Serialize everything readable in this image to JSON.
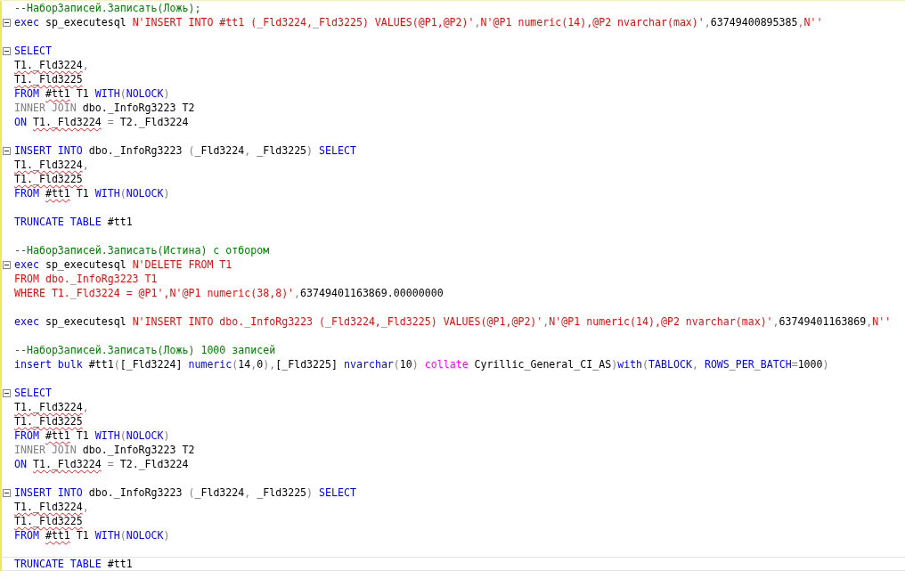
{
  "editor": {
    "lines": [
      {
        "fold": false,
        "current": false,
        "tokens": [
          {
            "kind": "comment",
            "t": "--НаборЗаписей.Записать(Ложь);"
          }
        ]
      },
      {
        "fold": true,
        "current": false,
        "tokens": [
          {
            "kind": "keyword",
            "t": "exec "
          },
          {
            "kind": "plain",
            "t": "sp_executesql "
          },
          {
            "kind": "string",
            "t": "N'INSERT INTO #tt1 (_Fld3224,_Fld3225) VALUES(@P1,@P2)'"
          },
          {
            "kind": "operator",
            "t": ","
          },
          {
            "kind": "string",
            "t": "N'@P1 numeric(14),@P2 nvarchar(max)'"
          },
          {
            "kind": "operator",
            "t": ","
          },
          {
            "kind": "plain",
            "t": "63749400895385"
          },
          {
            "kind": "operator",
            "t": ","
          },
          {
            "kind": "string",
            "t": "N''"
          }
        ]
      },
      {
        "fold": false,
        "current": false
      },
      {
        "fold": true,
        "current": false,
        "tokens": [
          {
            "kind": "keyword",
            "t": "SELECT"
          }
        ]
      },
      {
        "fold": false,
        "current": false,
        "tokens": [
          {
            "kind": "error",
            "t": "T1._Fld3224"
          },
          {
            "kind": "operator",
            "t": ","
          }
        ]
      },
      {
        "fold": false,
        "current": false,
        "tokens": [
          {
            "kind": "error",
            "t": "T1._Fld3225"
          }
        ]
      },
      {
        "fold": false,
        "current": false,
        "tokens": [
          {
            "kind": "keyword",
            "t": "FROM "
          },
          {
            "kind": "error",
            "t": "#tt1"
          },
          {
            "kind": "plain",
            "t": " T1 "
          },
          {
            "kind": "keyword",
            "t": "WITH"
          },
          {
            "kind": "operator",
            "t": "("
          },
          {
            "kind": "keyword",
            "t": "NOLOCK"
          },
          {
            "kind": "operator",
            "t": ")"
          }
        ]
      },
      {
        "fold": false,
        "current": false,
        "tokens": [
          {
            "kind": "operator",
            "t": "INNER JOIN "
          },
          {
            "kind": "plain",
            "t": "dbo._InfoRg3223 T2"
          }
        ]
      },
      {
        "fold": false,
        "current": false,
        "tokens": [
          {
            "kind": "keyword",
            "t": "ON "
          },
          {
            "kind": "error",
            "t": "T1._Fld3224"
          },
          {
            "kind": "operator",
            "t": " = "
          },
          {
            "kind": "plain",
            "t": "T2._Fld3224"
          }
        ]
      },
      {
        "fold": false,
        "current": false
      },
      {
        "fold": true,
        "current": false,
        "tokens": [
          {
            "kind": "keyword",
            "t": "INSERT INTO "
          },
          {
            "kind": "plain",
            "t": "dbo._InfoRg3223 "
          },
          {
            "kind": "operator",
            "t": "("
          },
          {
            "kind": "plain",
            "t": "_Fld3224"
          },
          {
            "kind": "operator",
            "t": ", "
          },
          {
            "kind": "plain",
            "t": "_Fld3225"
          },
          {
            "kind": "operator",
            "t": ") "
          },
          {
            "kind": "keyword",
            "t": "SELECT"
          }
        ]
      },
      {
        "fold": false,
        "current": false,
        "tokens": [
          {
            "kind": "error",
            "t": "T1._Fld3224"
          },
          {
            "kind": "operator",
            "t": ","
          }
        ]
      },
      {
        "fold": false,
        "current": false,
        "tokens": [
          {
            "kind": "error",
            "t": "T1._Fld3225"
          }
        ]
      },
      {
        "fold": false,
        "current": false,
        "tokens": [
          {
            "kind": "keyword",
            "t": "FROM "
          },
          {
            "kind": "error",
            "t": "#tt1"
          },
          {
            "kind": "plain",
            "t": " T1 "
          },
          {
            "kind": "keyword",
            "t": "WITH"
          },
          {
            "kind": "operator",
            "t": "("
          },
          {
            "kind": "keyword",
            "t": "NOLOCK"
          },
          {
            "kind": "operator",
            "t": ")"
          }
        ]
      },
      {
        "fold": false,
        "current": false
      },
      {
        "fold": false,
        "current": false,
        "tokens": [
          {
            "kind": "keyword",
            "t": "TRUNCATE TABLE "
          },
          {
            "kind": "plain",
            "t": "#tt1"
          }
        ]
      },
      {
        "fold": false,
        "current": false
      },
      {
        "fold": false,
        "current": false,
        "tokens": [
          {
            "kind": "comment",
            "t": "--НаборЗаписей.Записать(Истина) с отбором"
          }
        ]
      },
      {
        "fold": true,
        "current": false,
        "tokens": [
          {
            "kind": "keyword",
            "t": "exec "
          },
          {
            "kind": "plain",
            "t": "sp_executesql "
          },
          {
            "kind": "string",
            "t": "N'DELETE FROM T1"
          }
        ]
      },
      {
        "fold": false,
        "current": false,
        "tokens": [
          {
            "kind": "string",
            "t": "FROM dbo._InfoRg3223 T1"
          }
        ]
      },
      {
        "fold": false,
        "current": false,
        "tokens": [
          {
            "kind": "string",
            "t": "WHERE T1._Fld3224 = @P1',N'@P1 numeric(38,8)'"
          },
          {
            "kind": "operator",
            "t": ","
          },
          {
            "kind": "plain",
            "t": "63749401163869.00000000"
          }
        ]
      },
      {
        "fold": false,
        "current": false
      },
      {
        "fold": false,
        "current": false,
        "tokens": [
          {
            "kind": "keyword",
            "t": "exec "
          },
          {
            "kind": "plain",
            "t": "sp_executesql "
          },
          {
            "kind": "string",
            "t": "N'INSERT INTO dbo._InfoRg3223 (_Fld3224,_Fld3225) VALUES(@P1,@P2)'"
          },
          {
            "kind": "operator",
            "t": ","
          },
          {
            "kind": "string",
            "t": "N'@P1 numeric(14),@P2 nvarchar(max)'"
          },
          {
            "kind": "operator",
            "t": ","
          },
          {
            "kind": "plain",
            "t": "63749401163869"
          },
          {
            "kind": "operator",
            "t": ","
          },
          {
            "kind": "string",
            "t": "N''"
          }
        ]
      },
      {
        "fold": false,
        "current": false
      },
      {
        "fold": false,
        "current": false,
        "tokens": [
          {
            "kind": "comment",
            "t": "--НаборЗаписей.Записать(Ложь) 1000 записей"
          }
        ]
      },
      {
        "fold": false,
        "current": false,
        "tokens": [
          {
            "kind": "keyword",
            "t": "insert bulk "
          },
          {
            "kind": "plain",
            "t": "#tt1"
          },
          {
            "kind": "operator",
            "t": "("
          },
          {
            "kind": "plain",
            "t": "[_Fld3224] "
          },
          {
            "kind": "keyword",
            "t": "numeric"
          },
          {
            "kind": "operator",
            "t": "("
          },
          {
            "kind": "plain",
            "t": "14"
          },
          {
            "kind": "operator",
            "t": ","
          },
          {
            "kind": "plain",
            "t": "0"
          },
          {
            "kind": "operator",
            "t": "),"
          },
          {
            "kind": "plain",
            "t": "[_Fld3225] "
          },
          {
            "kind": "keyword",
            "t": "nvarchar"
          },
          {
            "kind": "operator",
            "t": "("
          },
          {
            "kind": "plain",
            "t": "10"
          },
          {
            "kind": "operator",
            "t": ") "
          },
          {
            "kind": "function",
            "t": "collate "
          },
          {
            "kind": "plain",
            "t": "Cyrillic_General_CI_AS"
          },
          {
            "kind": "operator",
            "t": ")"
          },
          {
            "kind": "keyword",
            "t": "with"
          },
          {
            "kind": "operator",
            "t": "("
          },
          {
            "kind": "keyword",
            "t": "TABLOCK"
          },
          {
            "kind": "operator",
            "t": ", "
          },
          {
            "kind": "keyword",
            "t": "ROWS_PER_BATCH"
          },
          {
            "kind": "operator",
            "t": "="
          },
          {
            "kind": "plain",
            "t": "1000"
          },
          {
            "kind": "operator",
            "t": ")"
          }
        ]
      },
      {
        "fold": false,
        "current": false
      },
      {
        "fold": true,
        "current": false,
        "tokens": [
          {
            "kind": "keyword",
            "t": "SELECT"
          }
        ]
      },
      {
        "fold": false,
        "current": false,
        "tokens": [
          {
            "kind": "error",
            "t": "T1._Fld3224"
          },
          {
            "kind": "operator",
            "t": ","
          }
        ]
      },
      {
        "fold": false,
        "current": false,
        "tokens": [
          {
            "kind": "error",
            "t": "T1._Fld3225"
          }
        ]
      },
      {
        "fold": false,
        "current": false,
        "tokens": [
          {
            "kind": "keyword",
            "t": "FROM "
          },
          {
            "kind": "error",
            "t": "#tt1"
          },
          {
            "kind": "plain",
            "t": " T1 "
          },
          {
            "kind": "keyword",
            "t": "WITH"
          },
          {
            "kind": "operator",
            "t": "("
          },
          {
            "kind": "keyword",
            "t": "NOLOCK"
          },
          {
            "kind": "operator",
            "t": ")"
          }
        ]
      },
      {
        "fold": false,
        "current": false,
        "tokens": [
          {
            "kind": "operator",
            "t": "INNER JOIN "
          },
          {
            "kind": "plain",
            "t": "dbo._InfoRg3223 T2"
          }
        ]
      },
      {
        "fold": false,
        "current": false,
        "tokens": [
          {
            "kind": "keyword",
            "t": "ON "
          },
          {
            "kind": "error",
            "t": "T1._Fld3224"
          },
          {
            "kind": "operator",
            "t": " = "
          },
          {
            "kind": "plain",
            "t": "T2._Fld3224"
          }
        ]
      },
      {
        "fold": false,
        "current": false
      },
      {
        "fold": true,
        "current": false,
        "tokens": [
          {
            "kind": "keyword",
            "t": "INSERT INTO "
          },
          {
            "kind": "plain",
            "t": "dbo._InfoRg3223 "
          },
          {
            "kind": "operator",
            "t": "("
          },
          {
            "kind": "plain",
            "t": "_Fld3224"
          },
          {
            "kind": "operator",
            "t": ", "
          },
          {
            "kind": "plain",
            "t": "_Fld3225"
          },
          {
            "kind": "operator",
            "t": ") "
          },
          {
            "kind": "keyword",
            "t": "SELECT"
          }
        ]
      },
      {
        "fold": false,
        "current": false,
        "tokens": [
          {
            "kind": "error",
            "t": "T1._Fld3224"
          },
          {
            "kind": "operator",
            "t": ","
          }
        ]
      },
      {
        "fold": false,
        "current": false,
        "tokens": [
          {
            "kind": "error",
            "t": "T1._Fld3225"
          }
        ]
      },
      {
        "fold": false,
        "current": false,
        "tokens": [
          {
            "kind": "keyword",
            "t": "FROM "
          },
          {
            "kind": "error",
            "t": "#tt1"
          },
          {
            "kind": "plain",
            "t": " T1 "
          },
          {
            "kind": "keyword",
            "t": "WITH"
          },
          {
            "kind": "operator",
            "t": "("
          },
          {
            "kind": "keyword",
            "t": "NOLOCK"
          },
          {
            "kind": "operator",
            "t": ")"
          }
        ]
      },
      {
        "fold": false,
        "current": false
      },
      {
        "fold": false,
        "current": true,
        "tokens": [
          {
            "kind": "keyword",
            "t": "TRUNCATE TABLE "
          },
          {
            "kind": "plain",
            "t": "#tt1"
          }
        ]
      }
    ]
  }
}
